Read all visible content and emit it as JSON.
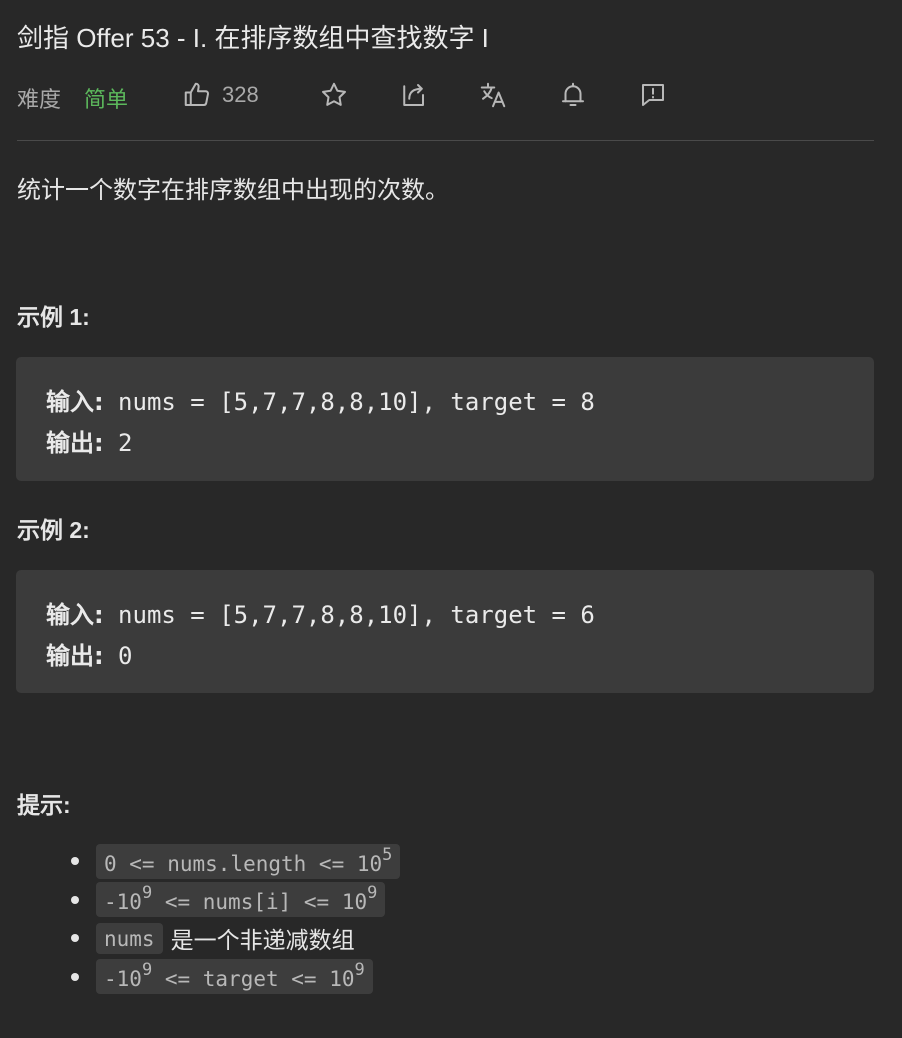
{
  "problem": {
    "title": "剑指 Offer 53 - I. 在排序数组中查找数字 I",
    "difficulty_label": "难度",
    "difficulty_value": "简单",
    "likes": "328",
    "description": "统计一个数字在排序数组中出现的次数。"
  },
  "icons": {
    "like": "thumbs-up-icon",
    "favorite": "star-icon",
    "share": "share-icon",
    "translate": "translate-icon",
    "notify": "bell-icon",
    "feedback": "feedback-icon"
  },
  "colors": {
    "background": "#282828",
    "easy": "#5cb85c",
    "code_bg": "#3b3b3b"
  },
  "examples": [
    {
      "heading": "示例 1:",
      "input_label": "输入:",
      "input_value": " nums = [5,7,7,8,8,10], target = 8",
      "output_label": "输出:",
      "output_value": " 2"
    },
    {
      "heading": "示例 2:",
      "input_label": "输入:",
      "input_value": " nums = [5,7,7,8,8,10], target = 6",
      "output_label": "输出:",
      "output_value": " 0"
    }
  ],
  "hints": {
    "heading": "提示:",
    "items": [
      {
        "code": "0 <= nums.length <= 10",
        "sup": "5"
      },
      {
        "code_a": "-10",
        "sup_a": "9",
        "code_b": " <= nums[i] <= 10",
        "sup_b": "9"
      },
      {
        "code": "nums",
        "text": "是一个非递减数组"
      },
      {
        "code_a": "-10",
        "sup_a": "9",
        "code_b": " <= target <= 10",
        "sup_b": "9"
      }
    ]
  }
}
